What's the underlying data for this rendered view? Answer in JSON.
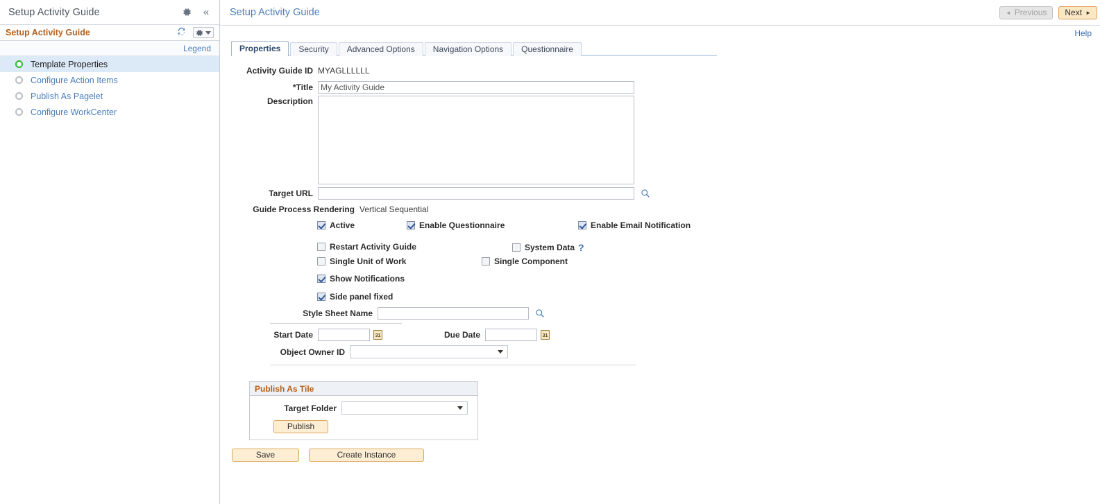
{
  "sidebar": {
    "top_title": "Setup Activity Guide",
    "gear_icon": "gear-icon",
    "collapse_icon": "chevron-double-left-icon",
    "sub_title": "Setup Activity Guide",
    "refresh_icon": "refresh-icon",
    "actions_icon": "gear-dropdown-icon",
    "legend_label": "Legend",
    "items": [
      {
        "label": "Template Properties",
        "status": "in-progress",
        "selected": true
      },
      {
        "label": "Configure Action Items",
        "status": "not-started",
        "selected": false
      },
      {
        "label": "Publish As Pagelet",
        "status": "not-started",
        "selected": false
      },
      {
        "label": "Configure WorkCenter",
        "status": "not-started",
        "selected": false
      }
    ]
  },
  "header": {
    "title": "Setup Activity Guide",
    "previous_label": "Previous",
    "next_label": "Next",
    "help_label": "Help"
  },
  "tabs": [
    {
      "label": "Properties",
      "selected": true
    },
    {
      "label": "Security",
      "selected": false
    },
    {
      "label": "Advanced Options",
      "selected": false
    },
    {
      "label": "Navigation Options",
      "selected": false
    },
    {
      "label": "Questionnaire",
      "selected": false
    }
  ],
  "form": {
    "activity_guide_id_label": "Activity Guide ID",
    "activity_guide_id_value": "MYAGLLLLLL",
    "title_label": "*Title",
    "title_value": "My Activity Guide",
    "description_label": "Description",
    "description_value": "",
    "target_url_label": "Target URL",
    "target_url_value": "",
    "target_url_search_icon": "search-icon",
    "guide_process_rendering_label": "Guide Process Rendering",
    "guide_process_rendering_value": "Vertical Sequential",
    "checkboxes": [
      {
        "label": "Active",
        "checked": true
      },
      {
        "label": "Enable Questionnaire",
        "checked": true
      },
      {
        "label": "Enable Email Notification",
        "checked": true
      },
      {
        "label": "Restart Activity Guide",
        "checked": false
      },
      {
        "label": "System Data",
        "checked": false,
        "help_icon": "?"
      },
      {
        "label": "Single Unit of Work",
        "checked": false
      },
      {
        "label": "Single Component",
        "checked": false
      },
      {
        "label": "Show Notifications",
        "checked": true
      },
      {
        "label": "Side panel fixed",
        "checked": true
      }
    ],
    "style_sheet_label": "Style Sheet Name",
    "style_sheet_value": "",
    "style_sheet_search_icon": "search-icon",
    "start_date_label": "Start Date",
    "start_date_value": "",
    "start_date_calendar_icon": "calendar-icon",
    "due_date_label": "Due Date",
    "due_date_value": "",
    "due_date_calendar_icon": "calendar-icon",
    "object_owner_label": "Object Owner ID",
    "object_owner_value": "",
    "object_owner_options": [
      ""
    ]
  },
  "publish_tile": {
    "group_title": "Publish As Tile",
    "target_folder_label": "Target Folder",
    "target_folder_value": "",
    "target_folder_options": [
      ""
    ],
    "publish_button": "Publish"
  },
  "footer": {
    "save_label": "Save",
    "create_instance_label": "Create Instance"
  },
  "colors": {
    "accent_orange": "#b5601b",
    "link_blue": "#4a7ebb",
    "selected_row": "#dce9f7",
    "status_green": "#2db52d",
    "button_orange_border": "#d8a657",
    "button_orange_bg": "#fdeed3"
  }
}
